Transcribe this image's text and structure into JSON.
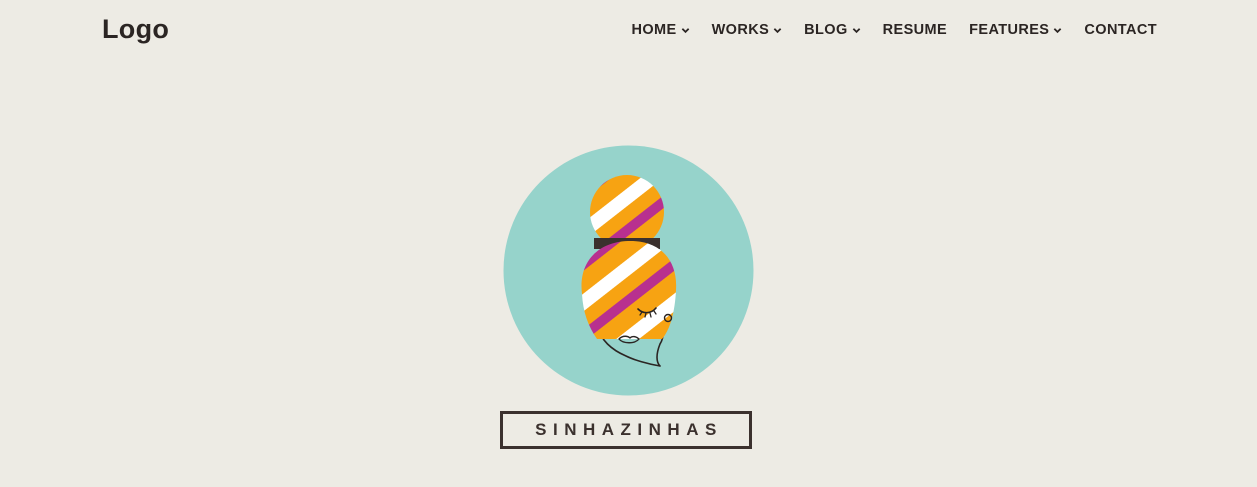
{
  "header": {
    "logo": "Logo",
    "nav": [
      {
        "label": "HOME",
        "dropdown": true
      },
      {
        "label": "WORKS",
        "dropdown": true
      },
      {
        "label": "BLOG",
        "dropdown": true
      },
      {
        "label": "RESUME",
        "dropdown": false
      },
      {
        "label": "FEATURES",
        "dropdown": true
      },
      {
        "label": "CONTACT",
        "dropdown": false
      }
    ]
  },
  "hero": {
    "brand_name": "SINHAZINHAS",
    "emblem_icon": "woman-with-turban-icon"
  },
  "colors": {
    "background": "#edebe4",
    "text": "#2b2523",
    "circle": "#96d3cb",
    "orange": "#f7a312",
    "magenta": "#b8308f",
    "white": "#ffffff",
    "band": "#3b312e"
  }
}
